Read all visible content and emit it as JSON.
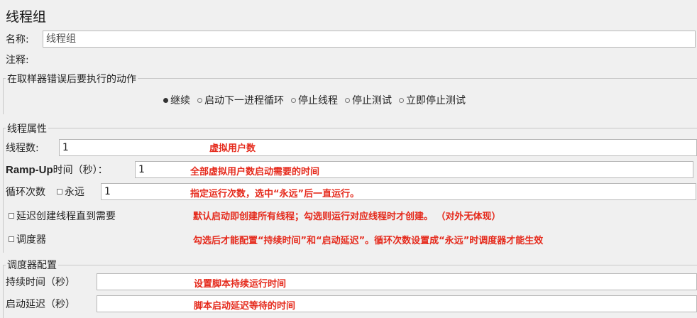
{
  "panel": {
    "title": "线程组"
  },
  "name_field": {
    "label": "名称:",
    "value": "线程组"
  },
  "comment_field": {
    "label": "注释:",
    "value": ""
  },
  "error_action": {
    "legend": "在取样器错误后要执行的动作",
    "options": [
      {
        "label": "继续",
        "selected": true
      },
      {
        "label": "启动下一进程循环",
        "selected": false
      },
      {
        "label": "停止线程",
        "selected": false
      },
      {
        "label": "停止测试",
        "selected": false
      },
      {
        "label": "立即停止测试",
        "selected": false
      }
    ]
  },
  "thread_props": {
    "legend": "线程属性",
    "threads": {
      "label": "线程数:",
      "value": "1",
      "annotation": "虚拟用户数"
    },
    "rampup": {
      "label_bold": "Ramp-Up",
      "label_rest": "时间（秒）：",
      "value": "1",
      "annotation": "全部虚拟用户数启动需要的时间"
    },
    "loops": {
      "label": "循环次数",
      "forever_label": "永远",
      "forever_checked": false,
      "value": "1",
      "annotation": "指定运行次数，选中“永远”后一直运行。"
    },
    "delay_create": {
      "label": "延迟创建线程直到需要",
      "checked": false,
      "annotation": "默认启动即创建所有线程；勾选则运行对应线程时才创建。 （对外无体现）"
    },
    "scheduler": {
      "label": "调度器",
      "checked": false,
      "annotation": "勾选后才能配置“持续时间”和“启动延迟”。循环次数设置成“永远”时调度器才能生效"
    }
  },
  "scheduler_config": {
    "legend": "调度器配置",
    "duration": {
      "label": "持续时间（秒）",
      "value": "",
      "annotation": "设置脚本持续运行时间"
    },
    "startup_delay": {
      "label": "启动延迟（秒）",
      "value": "",
      "annotation": "脚本启动延迟等待的时间"
    }
  },
  "colors": {
    "annotation": "#e52a1c",
    "background": "#f0f0f0"
  }
}
